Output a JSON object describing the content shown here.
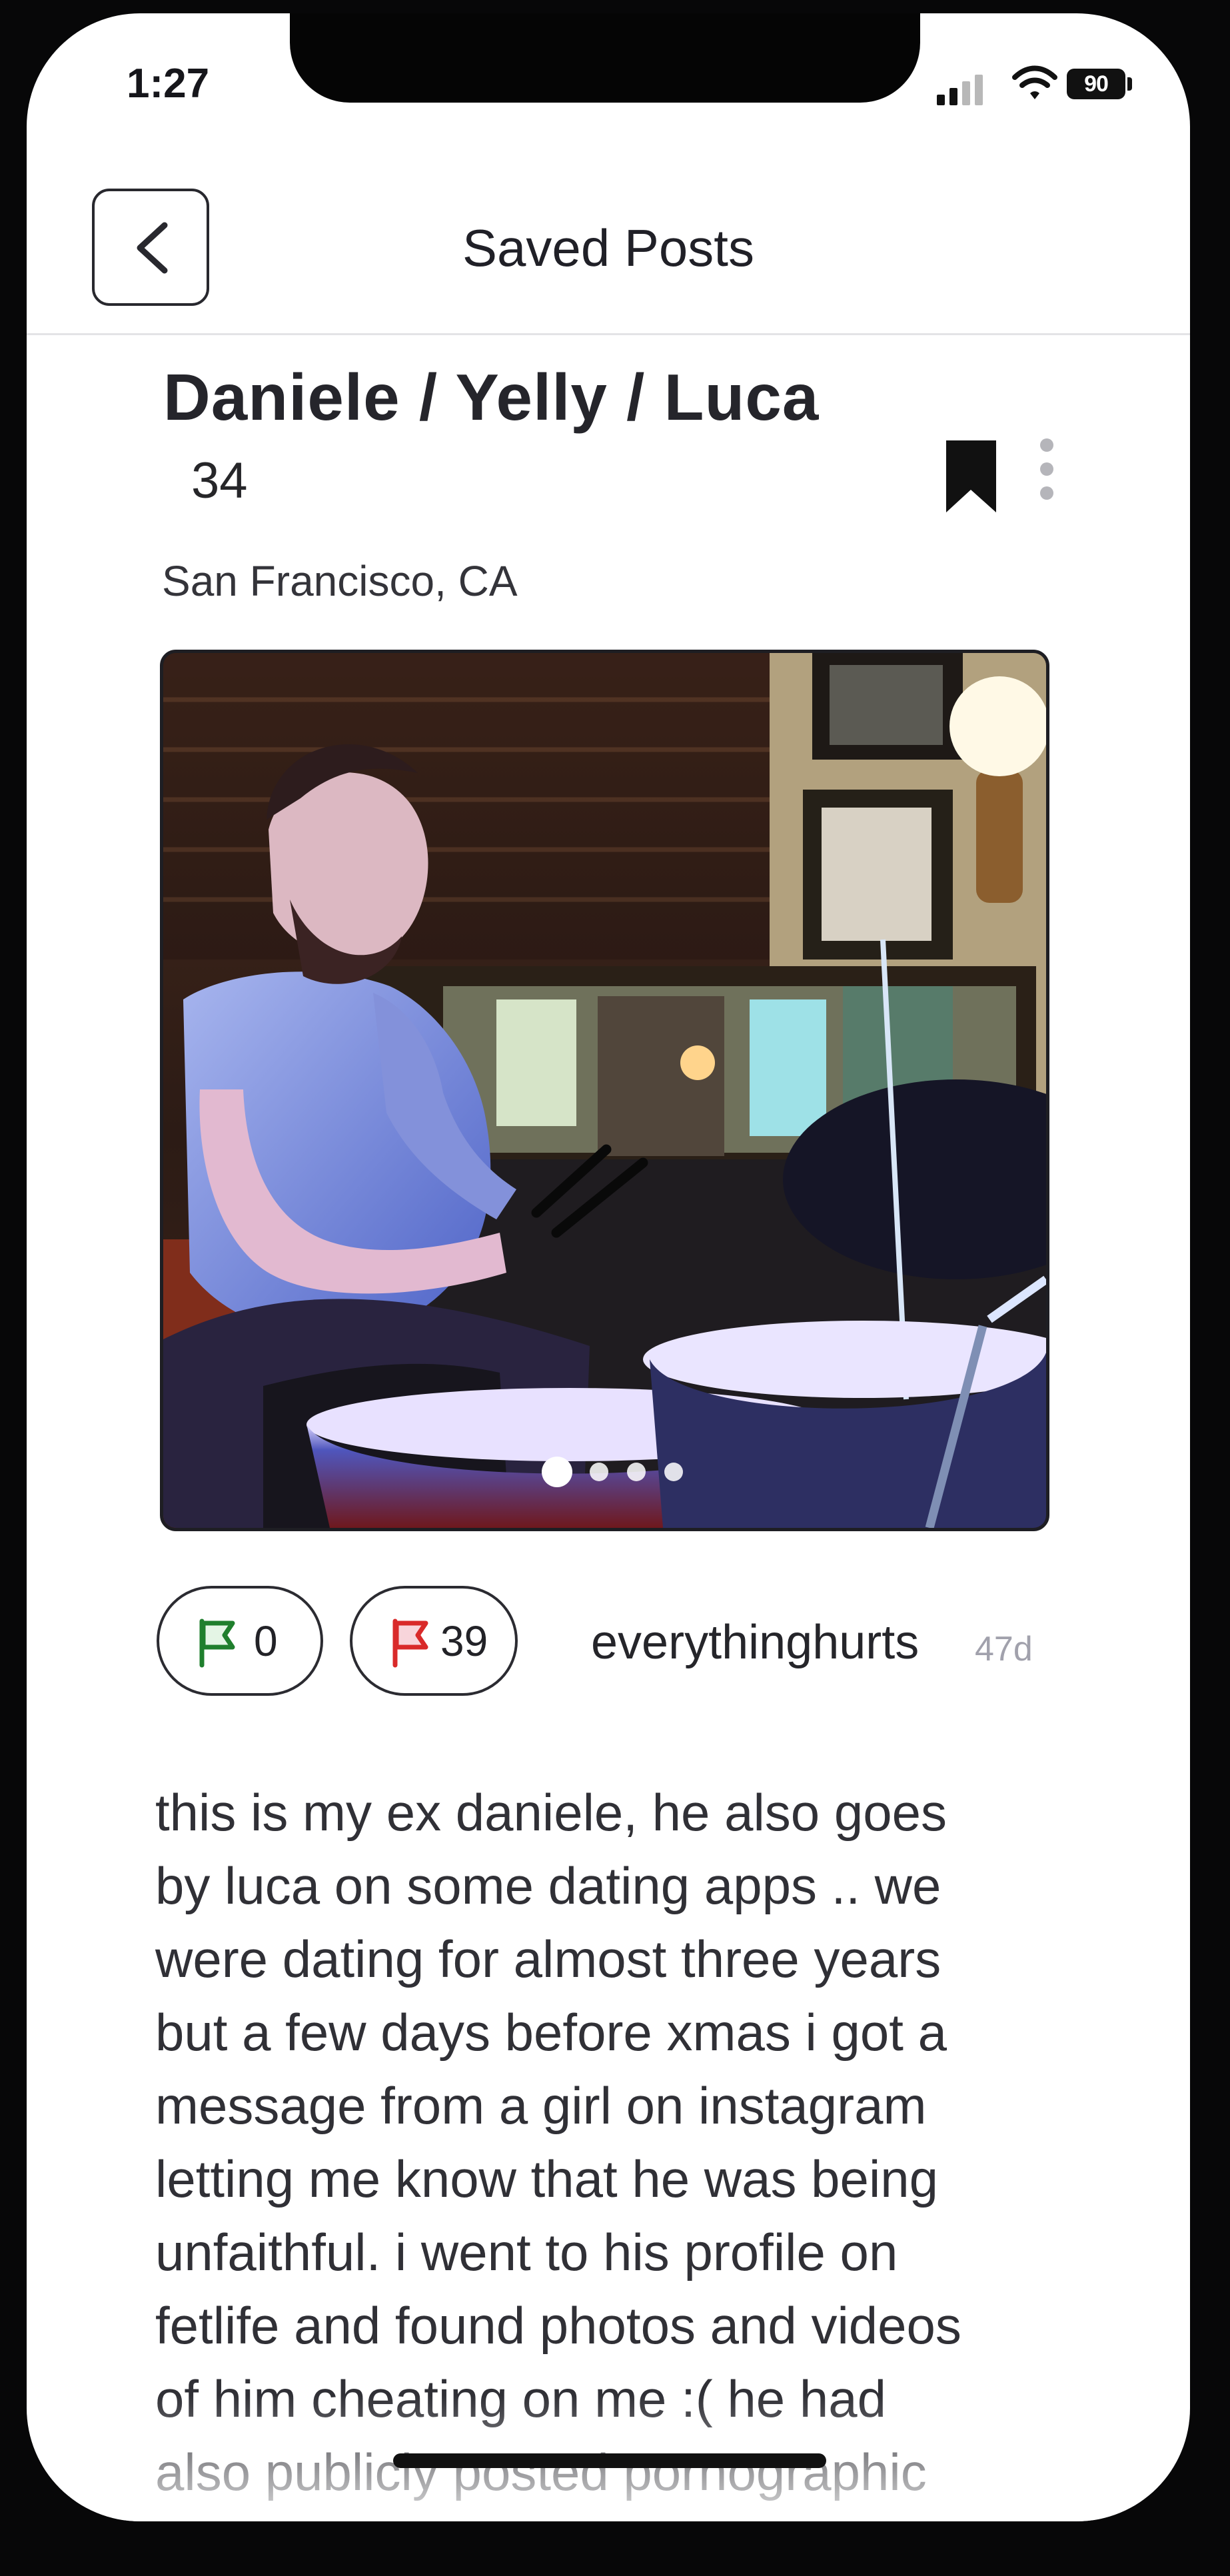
{
  "status_bar": {
    "time": "1:27",
    "battery": "90",
    "signal_icon": "cellular-signal-icon",
    "wifi_icon": "wifi-icon",
    "battery_icon": "battery-icon"
  },
  "header": {
    "title": "Saved Posts",
    "back_icon": "chevron-left-icon"
  },
  "post": {
    "title": "Daniele / Yelly / Luca",
    "age": "34",
    "location": "San Francisco, CA",
    "bookmark_icon": "bookmark-filled-icon",
    "more_icon": "more-vertical-icon",
    "photo": {
      "description_icon": "profile-photo",
      "carousel_count": 4,
      "active_index": 1
    },
    "green_flag_count": "0",
    "red_flag_count": "39",
    "green_flag_icon": "green-flag-icon",
    "red_flag_icon": "red-flag-icon",
    "author": "everythinghurts",
    "time_ago": "47d",
    "body": "this is my ex daniele, he also goes\nby luca on some dating apps .. we\nwere dating for almost three years\nbut a few days before xmas i got a\nmessage from a girl on instagram\nletting me know that he was being\nunfaithful. i went to his profile on\nfetlife and found photos and videos\nof him cheating on me :( he had\nalso publicly posted pornographic"
  },
  "colors": {
    "text": "#25252b",
    "muted": "#a1a1ac",
    "green_flag": "#1f7f2d",
    "red_flag": "#d92a2a",
    "border": "#2b2b31"
  }
}
